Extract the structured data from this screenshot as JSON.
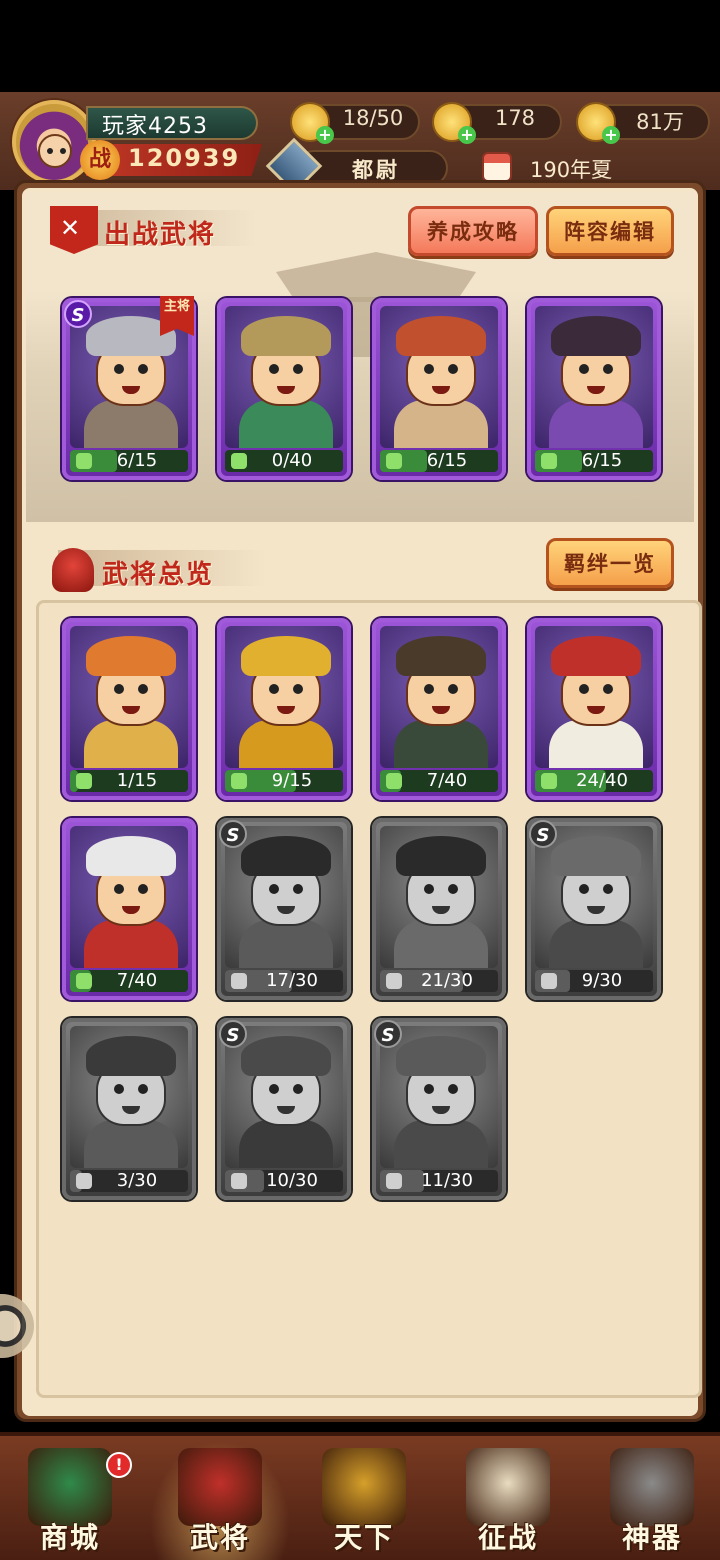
{
  "player": {
    "name": "玩家4253",
    "power_label": "战",
    "power": "120939",
    "rank": "都尉",
    "calendar": "190年夏"
  },
  "resources": [
    {
      "name": "stamina",
      "icon": "lightning-scroll-icon",
      "value": "18/50"
    },
    {
      "name": "gold-ingot",
      "icon": "gold-ingot-icon",
      "value": "178"
    },
    {
      "name": "coins",
      "icon": "coins-icon",
      "value": "81万"
    }
  ],
  "deployed": {
    "title": "出战武将",
    "guide_button": "养成攻略",
    "lineup_button": "阵容编辑",
    "main_tag": "主将",
    "heroes": [
      {
        "fragments": "6/15",
        "progress": 0.4,
        "style": "purple",
        "s_badge": "S",
        "main": true,
        "hat": "#b8b8c0",
        "body": "#8c7a6a"
      },
      {
        "fragments": "0/40",
        "progress": 0.0,
        "style": "purple",
        "s_badge": "",
        "main": false,
        "hat": "#b49a5a",
        "body": "#3a8a5a"
      },
      {
        "fragments": "6/15",
        "progress": 0.4,
        "style": "purple",
        "s_badge": "",
        "main": false,
        "hat": "#c0502e",
        "body": "#d6b48a"
      },
      {
        "fragments": "6/15",
        "progress": 0.4,
        "style": "purple",
        "s_badge": "",
        "main": false,
        "hat": "#3a2a3a",
        "body": "#7a4ab0"
      }
    ]
  },
  "overview": {
    "title": "武将总览",
    "bond_button": "羁绊一览",
    "heroes": [
      {
        "fragments": "1/15",
        "progress": 0.07,
        "style": "purple",
        "s_badge": "",
        "hat": "#e07a2e",
        "body": "#e0b04a"
      },
      {
        "fragments": "9/15",
        "progress": 0.6,
        "style": "purple",
        "s_badge": "",
        "hat": "#e0b02e",
        "body": "#d69a1e"
      },
      {
        "fragments": "7/40",
        "progress": 0.18,
        "style": "purple",
        "s_badge": "",
        "hat": "#4a3a2a",
        "body": "#3a4a3a"
      },
      {
        "fragments": "24/40",
        "progress": 0.6,
        "style": "purple",
        "s_badge": "",
        "hat": "#c0302a",
        "body": "#f0ece0"
      },
      {
        "fragments": "7/40",
        "progress": 0.18,
        "style": "purple",
        "s_badge": "",
        "hat": "#e8e8e8",
        "body": "#c0302a"
      },
      {
        "fragments": "17/30",
        "progress": 0.57,
        "style": "gray",
        "s_badge": "S",
        "hat": "#2a2a2a",
        "body": "#5a5a5a"
      },
      {
        "fragments": "21/30",
        "progress": 0.7,
        "style": "gray",
        "s_badge": "",
        "hat": "#2a2a2a",
        "body": "#6a6a6a"
      },
      {
        "fragments": "9/30",
        "progress": 0.3,
        "style": "gray",
        "s_badge": "S",
        "hat": "#6a6a6a",
        "body": "#4a4a4a"
      },
      {
        "fragments": "3/30",
        "progress": 0.1,
        "style": "gray",
        "s_badge": "",
        "hat": "#3a3a3a",
        "body": "#5a5a5a"
      },
      {
        "fragments": "10/30",
        "progress": 0.33,
        "style": "gray",
        "s_badge": "S",
        "hat": "#4a4a4a",
        "body": "#3a3a3a"
      },
      {
        "fragments": "11/30",
        "progress": 0.37,
        "style": "gray",
        "s_badge": "S",
        "hat": "#5a5a5a",
        "body": "#4a4a4a"
      }
    ]
  },
  "nav": [
    {
      "label": "商城",
      "icon": "shop-pavilion-icon",
      "badge": "!",
      "active": false,
      "color": "#2f8a4a"
    },
    {
      "label": "武将",
      "icon": "general-helmet-icon",
      "badge": "",
      "active": true,
      "color": "#c0302a"
    },
    {
      "label": "天下",
      "icon": "crossed-swords-icon",
      "badge": "",
      "active": false,
      "color": "#d6a02a"
    },
    {
      "label": "征战",
      "icon": "war-scroll-icon",
      "badge": "",
      "active": false,
      "color": "#e8dcc0"
    },
    {
      "label": "神器",
      "icon": "artifact-helmet-icon",
      "badge": "",
      "active": false,
      "color": "#8a8a8a"
    }
  ],
  "colors": {
    "accent_red": "#c0281c",
    "panel": "#f4e5c9",
    "purple_frame": "#a15ad9",
    "locked_gray": "#6a6a6a"
  }
}
